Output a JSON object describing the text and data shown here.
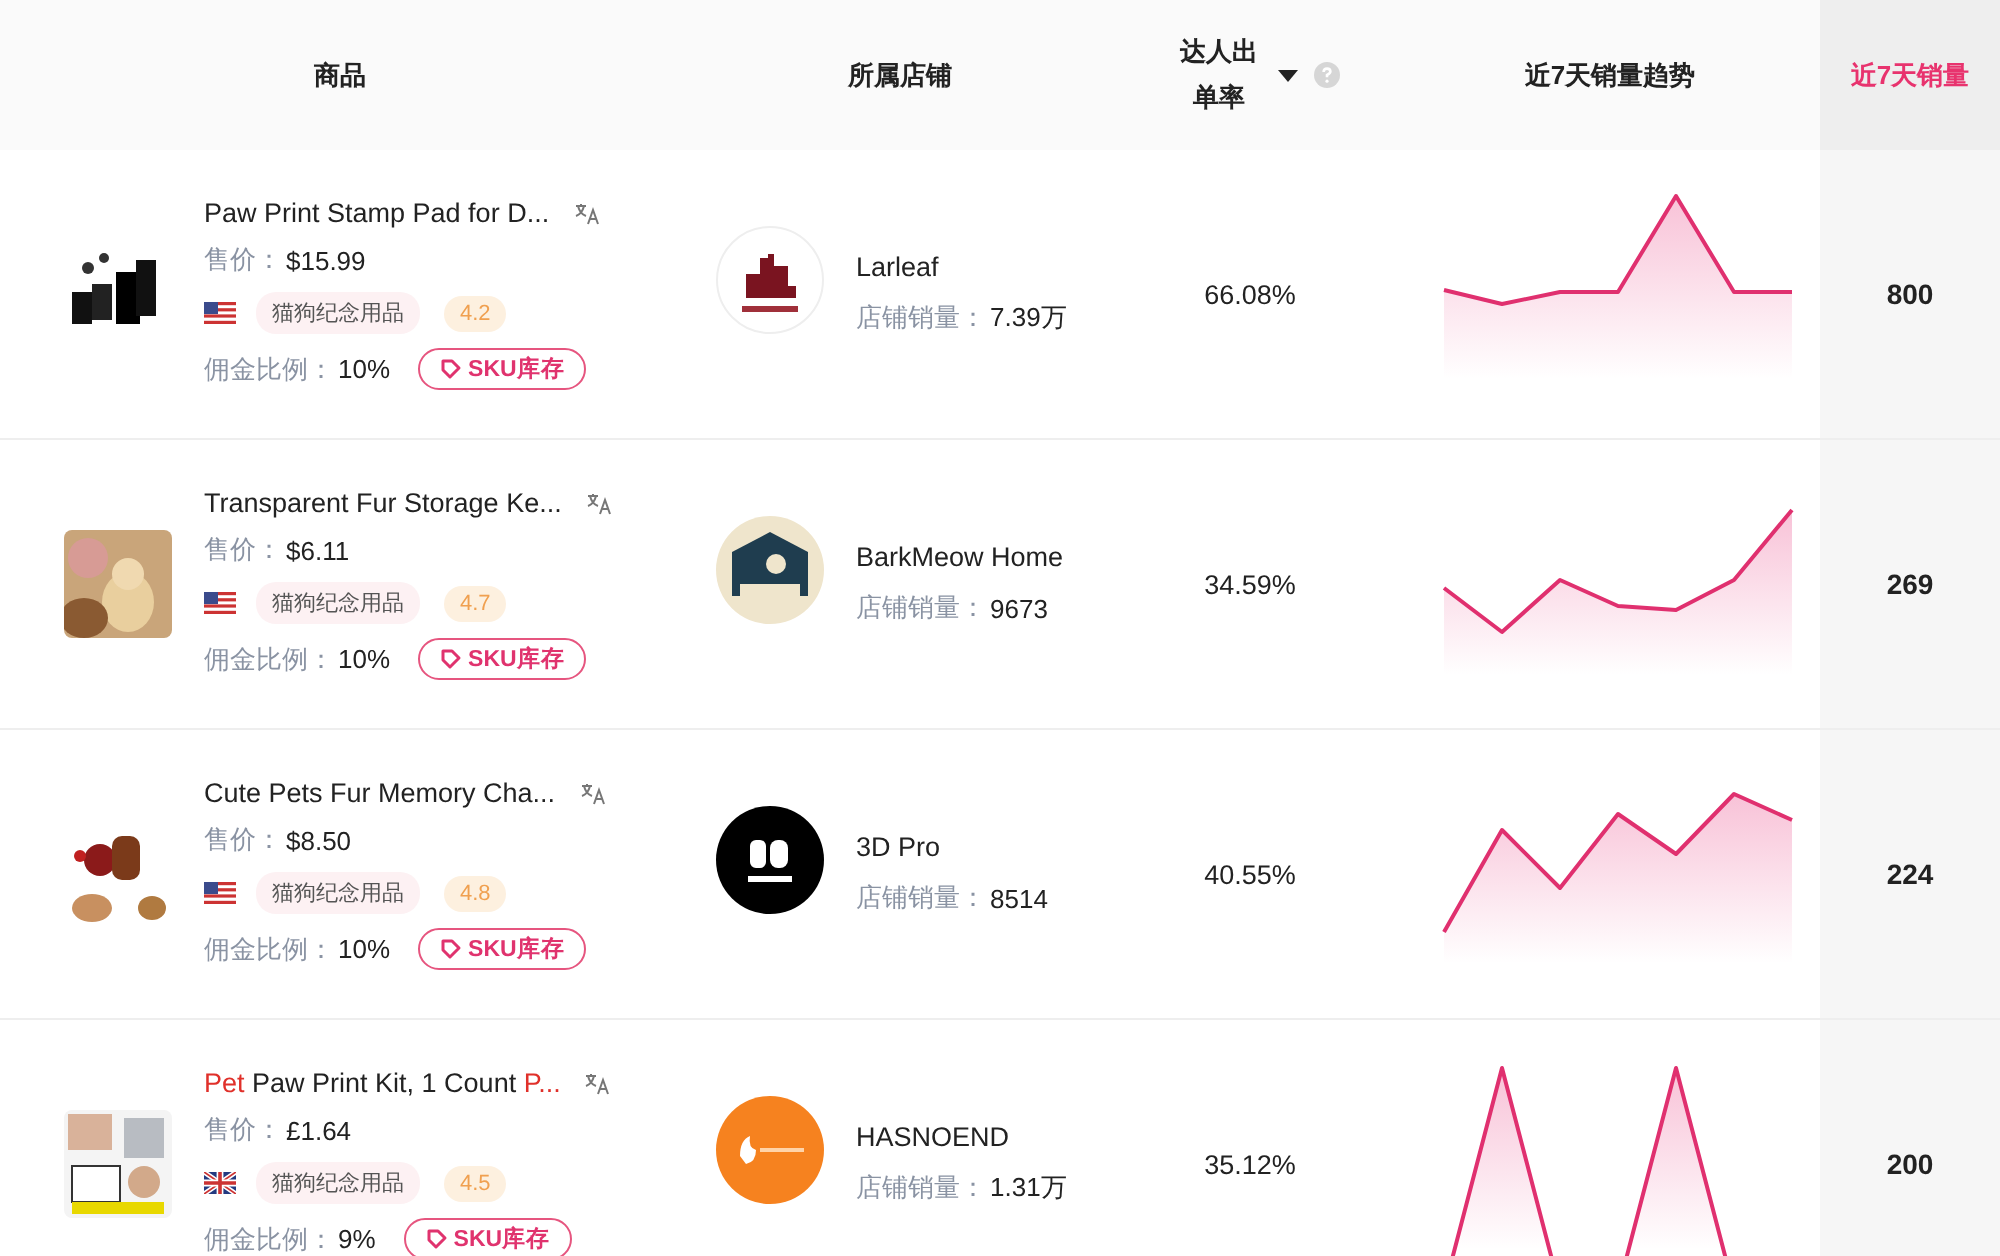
{
  "columns": [
    {
      "label": "商品",
      "kind": "plain",
      "highlighted": false
    },
    {
      "label": "所属店铺",
      "kind": "plain",
      "highlighted": false
    },
    {
      "label": "达人出单率",
      "kind": "sortable",
      "highlighted": false
    },
    {
      "label": "近7天销量趋势",
      "kind": "plain",
      "highlighted": false
    },
    {
      "label": "近7天销量",
      "kind": "plain",
      "highlighted": true
    }
  ],
  "rows": [
    {
      "product": {
        "title_parts": [
          {
            "text": "Paw Print Stamp Pad for D...",
            "highlight": false
          }
        ],
        "price_label": "售价：",
        "price": "$15.99",
        "flag": {
          "kind": "us"
        },
        "category": "猫狗纪念用品",
        "rating": "4.2",
        "commission_label": "佣金比例：",
        "commission": "10%",
        "sku_button": "SKU库存"
      },
      "store": {
        "name": "Larleaf",
        "logo": {
          "kind": "larleaf"
        },
        "sales_label": "店铺销量：",
        "sales": "7.39万"
      },
      "rate": "66.08%",
      "sales_7d": "800"
    },
    {
      "product": {
        "title_parts": [
          {
            "text": "Transparent Fur Storage Ke...",
            "highlight": false
          }
        ],
        "price_label": "售价：",
        "price": "$6.11",
        "flag": {
          "kind": "us"
        },
        "category": "猫狗纪念用品",
        "rating": "4.7",
        "commission_label": "佣金比例：",
        "commission": "10%",
        "sku_button": "SKU库存"
      },
      "store": {
        "name": "BarkMeow Home",
        "logo": {
          "kind": "barkmeow"
        },
        "sales_label": "店铺销量：",
        "sales": "9673"
      },
      "rate": "34.59%",
      "sales_7d": "269"
    },
    {
      "product": {
        "title_parts": [
          {
            "text": "Cute Pets Fur Memory Cha...",
            "highlight": false
          }
        ],
        "price_label": "售价：",
        "price": "$8.50",
        "flag": {
          "kind": "us"
        },
        "category": "猫狗纪念用品",
        "rating": "4.8",
        "commission_label": "佣金比例：",
        "commission": "10%",
        "sku_button": "SKU库存"
      },
      "store": {
        "name": "3D Pro",
        "logo": {
          "kind": "monogram"
        },
        "sales_label": "店铺销量：",
        "sales": "8514"
      },
      "rate": "40.55%",
      "sales_7d": "224"
    },
    {
      "product": {
        "title_parts": [
          {
            "text": "Pet",
            "highlight": true
          },
          {
            "text": " Paw Print Kit, 1 Count ",
            "highlight": false
          },
          {
            "text": "P...",
            "highlight": true
          }
        ],
        "price_label": "售价：",
        "price": "£1.64",
        "flag": {
          "kind": "gb"
        },
        "category": "猫狗纪念用品",
        "rating": "4.5",
        "commission_label": "佣金比例：",
        "commission": "9%",
        "sku_button": "SKU库存"
      },
      "store": {
        "name": "HASNOEND",
        "logo": {
          "kind": "hasnoend"
        },
        "sales_label": "店铺销量：",
        "sales": "1.31万"
      },
      "rate": "35.12%",
      "sales_7d": "200"
    }
  ]
}
